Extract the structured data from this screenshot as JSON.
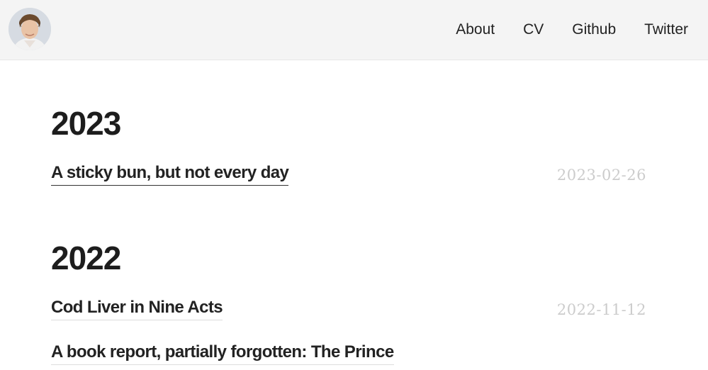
{
  "header": {
    "nav": [
      {
        "label": "About"
      },
      {
        "label": "CV"
      },
      {
        "label": "Github"
      },
      {
        "label": "Twitter"
      }
    ]
  },
  "sections": [
    {
      "year": "2023",
      "posts": [
        {
          "title": "A sticky bun, but not every day",
          "date": "2023-02-26"
        }
      ]
    },
    {
      "year": "2022",
      "posts": [
        {
          "title": "Cod Liver in Nine Acts",
          "date": "2022-11-12"
        },
        {
          "title": "A book report, partially forgotten: The Prince",
          "date": ""
        }
      ]
    }
  ]
}
